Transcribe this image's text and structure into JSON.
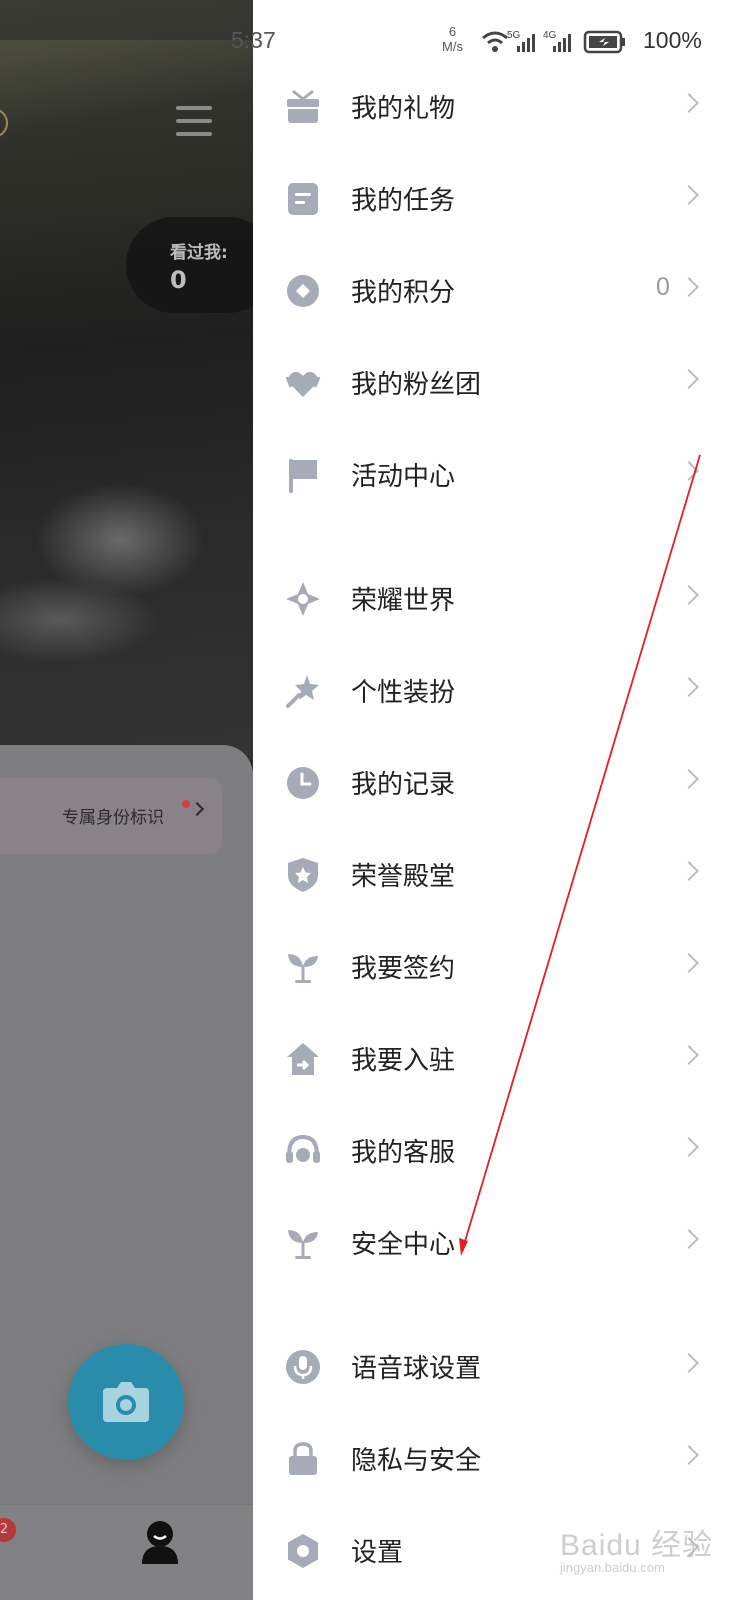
{
  "status_bar": {
    "time": "5:37",
    "net_speed_value": "6",
    "net_speed_unit": "M/s",
    "battery_percent": "100%"
  },
  "background_app": {
    "visitors_label": "看过我:",
    "visitors_count": "0",
    "identity_label": "专属身份标识",
    "nav_badge": "2"
  },
  "drawer": {
    "items": [
      {
        "label": "我的礼物",
        "icon": "gift-icon"
      },
      {
        "label": "我的任务",
        "icon": "task-icon"
      },
      {
        "label": "我的积分",
        "icon": "points-icon",
        "value": "0"
      },
      {
        "label": "我的粉丝团",
        "icon": "fans-heart-icon"
      },
      {
        "label": "活动中心",
        "icon": "flag-icon"
      },
      {
        "label": "荣耀世界",
        "icon": "honor-world-icon"
      },
      {
        "label": "个性装扮",
        "icon": "magic-wand-icon"
      },
      {
        "label": "我的记录",
        "icon": "clock-icon"
      },
      {
        "label": "荣誉殿堂",
        "icon": "shield-star-icon"
      },
      {
        "label": "我要签约",
        "icon": "sprout-icon"
      },
      {
        "label": "我要入驻",
        "icon": "home-enter-icon"
      },
      {
        "label": "我的客服",
        "icon": "headset-icon"
      },
      {
        "label": "安全中心",
        "icon": "sprout-icon"
      },
      {
        "label": "语音球设置",
        "icon": "microphone-icon"
      },
      {
        "label": "隐私与安全",
        "icon": "lock-icon"
      },
      {
        "label": "设置",
        "icon": "settings-hexagon-icon"
      }
    ]
  },
  "watermark": {
    "main": "Baidu 经验",
    "sub": "jingyan.baidu.com"
  },
  "colors": {
    "icon_gray": "#a6abb8",
    "chevron": "#b8bcc4",
    "annotation_arrow": "#e02020"
  }
}
